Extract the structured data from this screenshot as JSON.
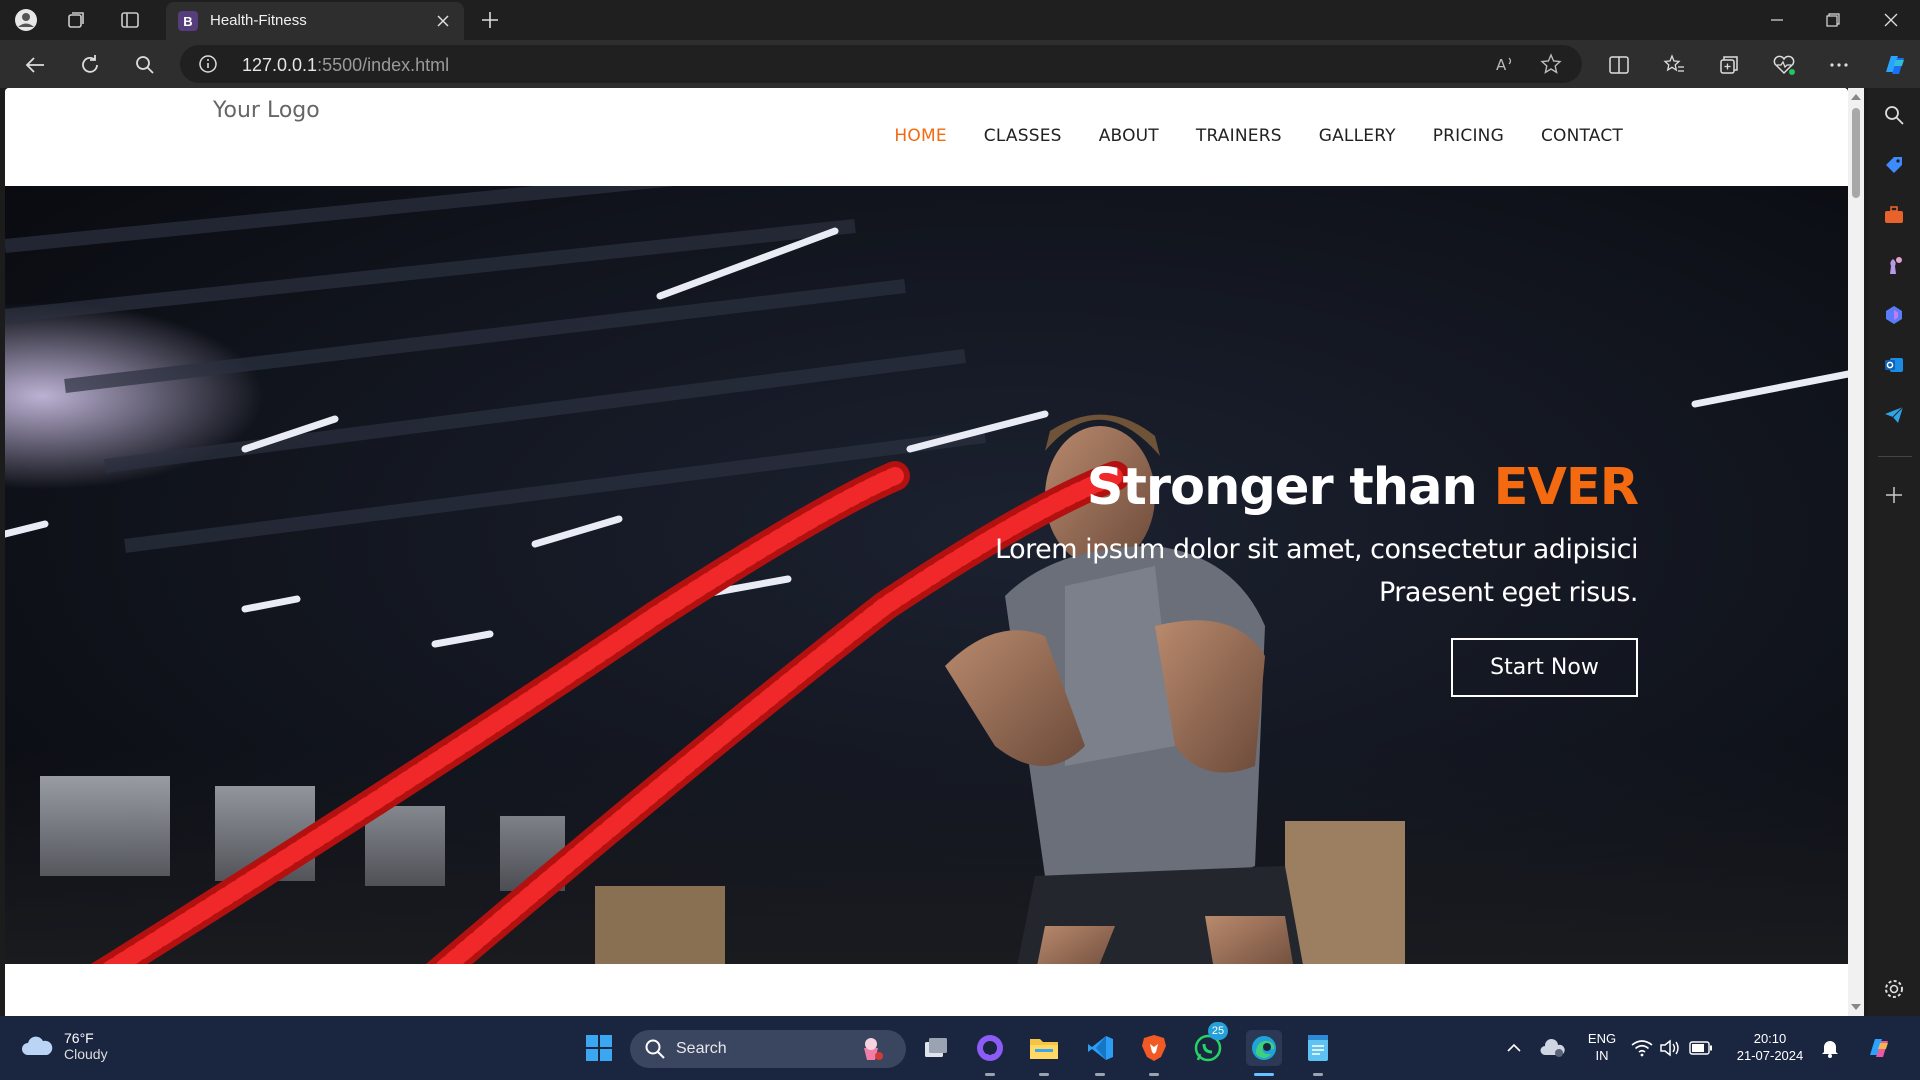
{
  "browser": {
    "tab_title": "Health-Fitness",
    "tab_favicon_letter": "B",
    "url_host": "127.0.0.1",
    "url_path": ":5500/index.html"
  },
  "site": {
    "logo": "Your Logo",
    "menu": [
      {
        "label": "HOME",
        "active": true
      },
      {
        "label": "CLASSES",
        "active": false
      },
      {
        "label": "ABOUT",
        "active": false
      },
      {
        "label": "TRAINERS",
        "active": false
      },
      {
        "label": "GALLERY",
        "active": false
      },
      {
        "label": "PRICING",
        "active": false
      },
      {
        "label": "CONTACT",
        "active": false
      }
    ],
    "hero": {
      "title_main": "Stronger than ",
      "title_accent": "EVER",
      "subtitle_line1": "Lorem ipsum dolor sit amet, consectetur adipisici",
      "subtitle_line2": "Praesent eget risus.",
      "cta_label": "Start Now"
    },
    "accent_color": "#f36a10"
  },
  "taskbar": {
    "weather_temp": "76°F",
    "weather_condition": "Cloudy",
    "search_label": "Search",
    "whatsapp_badge": "25",
    "lang_line1": "ENG",
    "lang_line2": "IN",
    "time": "20:10",
    "date": "21-07-2024"
  }
}
